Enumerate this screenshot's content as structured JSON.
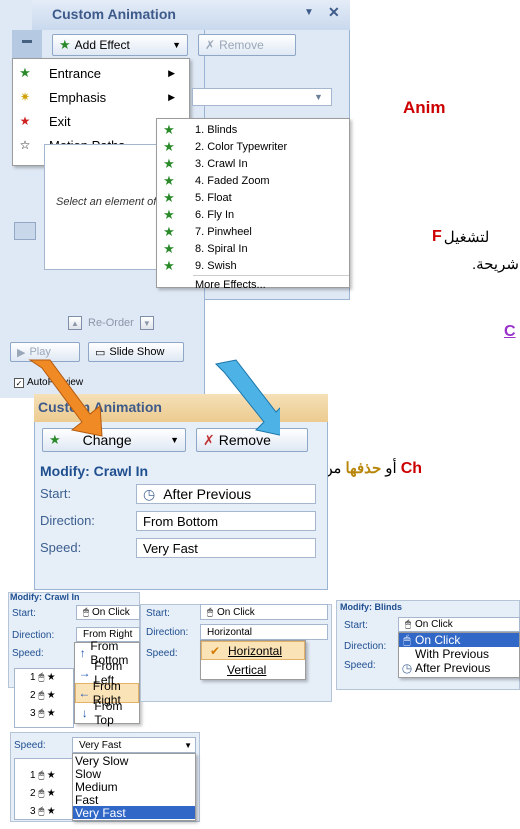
{
  "panel1": {
    "title": "Custom Animation",
    "add_effect": "Add Effect",
    "remove": "Remove",
    "hint": "Select an element of the slide, then click \"Add Effect\" to add animation.",
    "reorder": "Re-Order",
    "play": "Play",
    "slideshow": "Slide Show",
    "autopreview": "AutoPreview",
    "menu": [
      "Entrance",
      "Emphasis",
      "Exit",
      "Motion Paths"
    ],
    "submenu": [
      "1. Blinds",
      "2. Color Typewriter",
      "3. Crawl In",
      "4. Faded Zoom",
      "5. Float",
      "6. Fly In",
      "7. Pinwheel",
      "8. Spiral In",
      "9. Swish",
      "More Effects..."
    ]
  },
  "panel2": {
    "title": "Custom Animation",
    "change": "Change",
    "remove": "Remove",
    "modify": "Modify: Crawl In",
    "start_label": "Start:",
    "start_value": "After Previous",
    "direction_label": "Direction:",
    "direction_value": "From Bottom",
    "speed_label": "Speed:",
    "speed_value": "Very Fast"
  },
  "arabic": {
    "line1": "Anim",
    "line2_latin": "F",
    "line2": "لتشغيل",
    "line3": "شريحة.",
    "line4": "C",
    "line5_latin": "Ch",
    "line5_a": "أو",
    "line5_b": "حذفها",
    "line5_c": "من"
  },
  "shot_a": {
    "title": "Modify: Crawl In",
    "start": "Start:",
    "start_val": "On Click",
    "direction": "Direction:",
    "direction_val": "From Right",
    "speed": "Speed:",
    "options": [
      "From Bottom",
      "From Left",
      "From Right",
      "From Top"
    ],
    "rows": [
      "1",
      "2",
      "3"
    ]
  },
  "shot_b": {
    "start": "Start:",
    "start_val": "On Click",
    "direction": "Direction:",
    "direction_val": "Horizontal",
    "speed": "Speed:",
    "options": [
      "Horizontal",
      "Vertical"
    ]
  },
  "shot_c": {
    "title": "Modify: Blinds",
    "start": "Start:",
    "start_val": "On Click",
    "direction": "Direction:",
    "speed": "Speed:",
    "options": [
      "On Click",
      "With Previous",
      "After Previous"
    ]
  },
  "shot_d": {
    "speed": "Speed:",
    "speed_val": "Very Fast",
    "options": [
      "Very Slow",
      "Slow",
      "Medium",
      "Fast",
      "Very Fast"
    ],
    "rows": [
      "1",
      "2",
      "3"
    ]
  },
  "colors": {
    "red": "#cc0000",
    "gold": "#b8860b",
    "purple": "#9932cc",
    "accent": "#3168c8"
  }
}
